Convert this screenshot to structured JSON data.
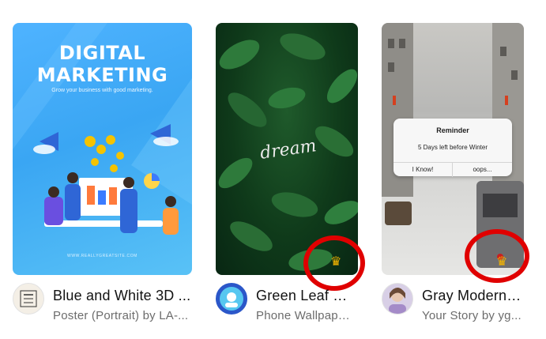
{
  "cards": [
    {
      "title": "Blue and White 3D ...",
      "subtitle": "Poster (Portrait) by LA-...",
      "design": {
        "headline_line1": "DIGITAL",
        "headline_line2": "MARKETING",
        "tagline": "Grow your business with good marketing.",
        "footer": "WWW.REALLYGREATSITE.COM"
      },
      "premium": false
    },
    {
      "title": "Green Leaf D...",
      "subtitle": "Phone Wallpape...",
      "design": {
        "script_word": "dream"
      },
      "premium": true,
      "highlighted": true
    },
    {
      "title": "Gray Modern ...",
      "subtitle": "Your Story by yg...",
      "design": {
        "popup_title": "Reminder",
        "popup_message": "5 Days left before Winter",
        "button_left": "I Know!",
        "button_right": "oops..."
      },
      "premium": true,
      "highlighted": true
    }
  ],
  "colors": {
    "premium_crown": "#f5b400",
    "highlight_ring": "#e00000"
  },
  "icons": {
    "premium": "crown-icon"
  }
}
